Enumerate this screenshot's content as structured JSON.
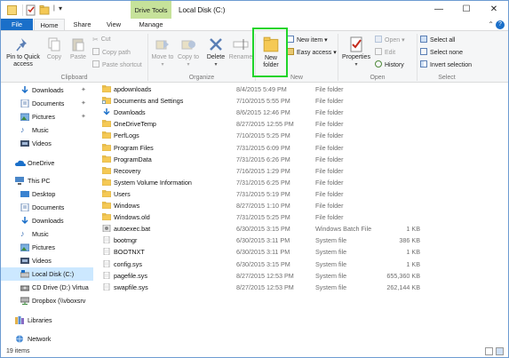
{
  "window": {
    "title": "Local Disk (C:)",
    "contextual_tab": "Drive Tools",
    "controls": {
      "minimize": "—",
      "maximize": "☐",
      "close": "✕"
    }
  },
  "ribbon_tabs": {
    "file": "File",
    "home": "Home",
    "share": "Share",
    "view": "View",
    "manage": "Manage",
    "collapse_icon": "chevron-up",
    "help": "?"
  },
  "ribbon": {
    "clipboard": {
      "label": "Clipboard",
      "pin": "Pin to Quick access",
      "copy": "Copy",
      "paste": "Paste",
      "cut": "Cut",
      "copy_path": "Copy path",
      "paste_shortcut": "Paste shortcut"
    },
    "organize": {
      "label": "Organize",
      "move_to": "Move to",
      "copy_to": "Copy to",
      "delete": "Delete",
      "rename": "Rename"
    },
    "new": {
      "label": "New",
      "new_folder": "New folder",
      "new_item": "New item",
      "easy_access": "Easy access"
    },
    "open": {
      "label": "Open",
      "properties": "Properties",
      "open": "Open",
      "edit": "Edit",
      "history": "History"
    },
    "select": {
      "label": "Select",
      "select_all": "Select all",
      "select_none": "Select none",
      "invert": "Invert selection"
    }
  },
  "nav": [
    {
      "label": "Downloads",
      "icon": "download-icon",
      "pinned": true
    },
    {
      "label": "Documents",
      "icon": "documents-icon",
      "pinned": true
    },
    {
      "label": "Pictures",
      "icon": "pictures-icon",
      "pinned": true
    },
    {
      "label": "Music",
      "icon": "music-icon",
      "pinned": false
    },
    {
      "label": "Videos",
      "icon": "videos-icon",
      "pinned": false
    },
    {
      "label": "OneDrive",
      "icon": "onedrive-icon",
      "pinned": false
    },
    {
      "label": "This PC",
      "icon": "pc-icon",
      "pinned": false
    },
    {
      "label": "Desktop",
      "icon": "desktop-icon",
      "pinned": false
    },
    {
      "label": "Documents",
      "icon": "documents-icon",
      "pinned": false
    },
    {
      "label": "Downloads",
      "icon": "download-icon",
      "pinned": false
    },
    {
      "label": "Music",
      "icon": "music-icon",
      "pinned": false
    },
    {
      "label": "Pictures",
      "icon": "pictures-icon",
      "pinned": false
    },
    {
      "label": "Videos",
      "icon": "videos-icon",
      "pinned": false
    },
    {
      "label": "Local Disk (C:)",
      "icon": "drive-icon",
      "pinned": false,
      "selected": true
    },
    {
      "label": "CD Drive (D:) Virtua",
      "icon": "cd-drive-icon",
      "pinned": false
    },
    {
      "label": "Dropbox (\\\\vboxsrv",
      "icon": "network-drive-icon",
      "pinned": false
    },
    {
      "label": "Libraries",
      "icon": "libraries-icon",
      "pinned": false
    },
    {
      "label": "Network",
      "icon": "network-icon",
      "pinned": false
    }
  ],
  "files": [
    {
      "name": "apdownloads",
      "date": "8/4/2015 5:49 PM",
      "type": "File folder",
      "size": "",
      "kind": "folder"
    },
    {
      "name": "Documents and Settings",
      "date": "7/10/2015 5:55 PM",
      "type": "File folder",
      "size": "",
      "kind": "folder-link"
    },
    {
      "name": "Downloads",
      "date": "8/6/2015 12:46 PM",
      "type": "File folder",
      "size": "",
      "kind": "download"
    },
    {
      "name": "OneDriveTemp",
      "date": "8/27/2015 12:55 PM",
      "type": "File folder",
      "size": "",
      "kind": "folder"
    },
    {
      "name": "PerfLogs",
      "date": "7/10/2015 5:25 PM",
      "type": "File folder",
      "size": "",
      "kind": "folder"
    },
    {
      "name": "Program Files",
      "date": "7/31/2015 6:09 PM",
      "type": "File folder",
      "size": "",
      "kind": "folder"
    },
    {
      "name": "ProgramData",
      "date": "7/31/2015 6:26 PM",
      "type": "File folder",
      "size": "",
      "kind": "folder"
    },
    {
      "name": "Recovery",
      "date": "7/16/2015 1:29 PM",
      "type": "File folder",
      "size": "",
      "kind": "folder"
    },
    {
      "name": "System Volume Information",
      "date": "7/31/2015 6:25 PM",
      "type": "File folder",
      "size": "",
      "kind": "folder"
    },
    {
      "name": "Users",
      "date": "7/31/2015 5:19 PM",
      "type": "File folder",
      "size": "",
      "kind": "folder"
    },
    {
      "name": "Windows",
      "date": "8/27/2015 1:10 PM",
      "type": "File folder",
      "size": "",
      "kind": "folder"
    },
    {
      "name": "Windows.old",
      "date": "7/31/2015 5:25 PM",
      "type": "File folder",
      "size": "",
      "kind": "folder"
    },
    {
      "name": "autoexec.bat",
      "date": "6/30/2015 3:15 PM",
      "type": "Windows Batch File",
      "size": "1 KB",
      "kind": "batch"
    },
    {
      "name": "bootmgr",
      "date": "6/30/2015 3:11 PM",
      "type": "System file",
      "size": "386 KB",
      "kind": "sysfile"
    },
    {
      "name": "BOOTNXT",
      "date": "6/30/2015 3:11 PM",
      "type": "System file",
      "size": "1 KB",
      "kind": "sysfile"
    },
    {
      "name": "config.sys",
      "date": "6/30/2015 3:15 PM",
      "type": "System file",
      "size": "1 KB",
      "kind": "sysfile"
    },
    {
      "name": "pagefile.sys",
      "date": "8/27/2015 12:53 PM",
      "type": "System file",
      "size": "655,360 KB",
      "kind": "sysfile"
    },
    {
      "name": "swapfile.sys",
      "date": "8/27/2015 12:53 PM",
      "type": "System file",
      "size": "262,144 KB",
      "kind": "sysfile"
    }
  ],
  "status": {
    "count": "19 items"
  },
  "colors": {
    "accent": "#1a6fc9",
    "folder": "#f5c955",
    "selection": "#cce8ff",
    "drive_tools": "#c6e29a",
    "highlight": "#1fd42a"
  }
}
